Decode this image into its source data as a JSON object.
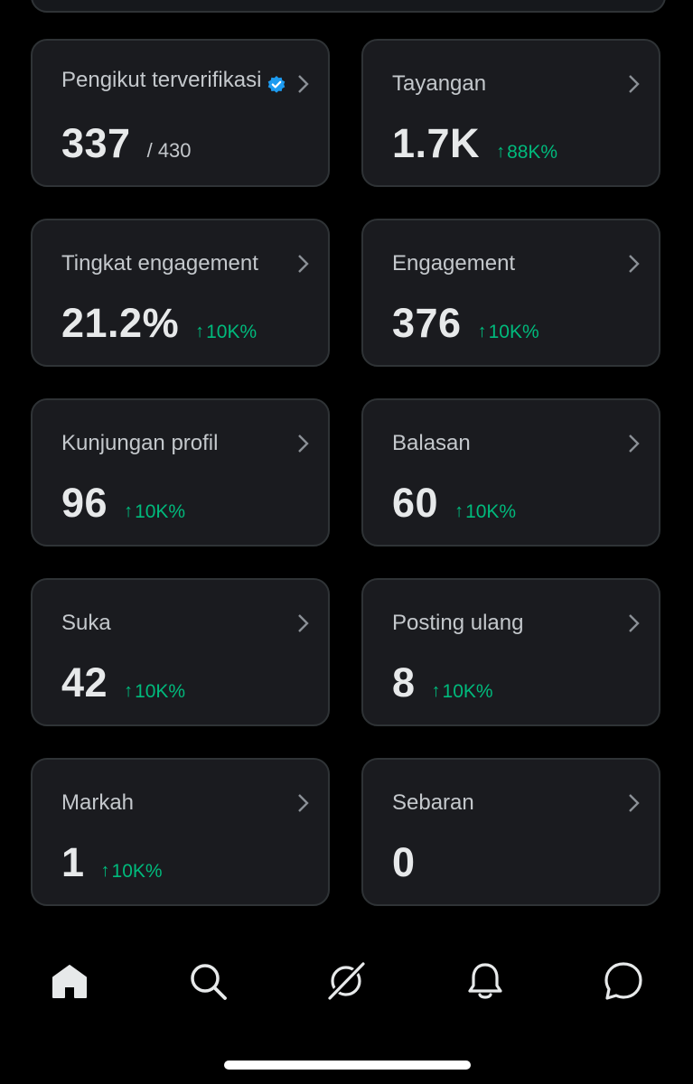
{
  "colors": {
    "background": "#000000",
    "card": "#1a1b1f",
    "card_border": "#2f3336",
    "text_primary": "#e7e9ea",
    "text_secondary": "#c4c8cc",
    "positive": "#00ba7c",
    "verified_blue": "#1d9bf0"
  },
  "cards": [
    {
      "label": "Pengikut terverifikasi",
      "value": "337",
      "sub": "/ 430",
      "verified": true
    },
    {
      "label": "Tayangan",
      "value": "1.7K",
      "delta": "88K%"
    },
    {
      "label": "Tingkat engagement",
      "value": "21.2%",
      "delta": "10K%"
    },
    {
      "label": "Engagement",
      "value": "376",
      "delta": "10K%"
    },
    {
      "label": "Kunjungan profil",
      "value": "96",
      "delta": "10K%"
    },
    {
      "label": "Balasan",
      "value": "60",
      "delta": "10K%"
    },
    {
      "label": "Suka",
      "value": "42",
      "delta": "10K%"
    },
    {
      "label": "Posting ulang",
      "value": "8",
      "delta": "10K%"
    },
    {
      "label": "Markah",
      "value": "1",
      "delta": "10K%"
    },
    {
      "label": "Sebaran",
      "value": "0"
    }
  ],
  "delta_arrow": "↑",
  "nav": {
    "items": [
      {
        "name": "home",
        "icon": "home-icon",
        "active": true
      },
      {
        "name": "search",
        "icon": "search-icon"
      },
      {
        "name": "grok",
        "icon": "grok-icon"
      },
      {
        "name": "notifications",
        "icon": "bell-icon"
      },
      {
        "name": "messages",
        "icon": "chat-bubble-icon"
      }
    ]
  }
}
